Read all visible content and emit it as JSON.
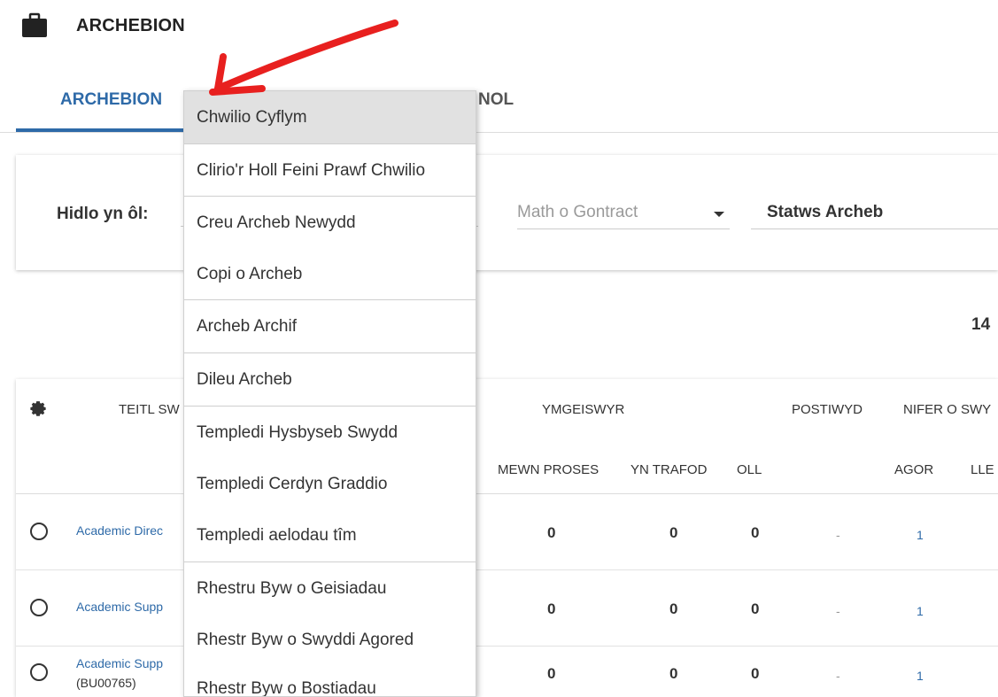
{
  "header": {
    "icon": "briefcase-icon",
    "title": "ARCHEBION"
  },
  "tabs": [
    {
      "label": "ARCHEBION",
      "active": true
    },
    {
      "label": "NOL",
      "active": false
    }
  ],
  "filter": {
    "label": "Hidlo yn ôl:",
    "contract_type_placeholder": "Math o Gontract",
    "status_label": "Statws Archeb"
  },
  "count": "14",
  "table": {
    "headers": {
      "title": "TEITL SW",
      "applicants": "YMGEISWYR",
      "posted": "POSTIWYD",
      "num_jobs": "NIFER O SWY",
      "in_process": "MEWN PROSES",
      "in_discussion": "YN TRAFOD",
      "all": "OLL",
      "open": "AGOR",
      "places": "LLE"
    },
    "rows": [
      {
        "title": "Academic Direc",
        "ref": "",
        "in_process": "0",
        "in_discussion": "0",
        "all": "0",
        "posted": "-",
        "open": "1"
      },
      {
        "title": "Academic Supp",
        "ref": "",
        "in_process": "0",
        "in_discussion": "0",
        "all": "0",
        "posted": "-",
        "open": "1"
      },
      {
        "title": "Academic Supp",
        "ref": "(BU00765)",
        "in_process": "0",
        "in_discussion": "0",
        "all": "0",
        "posted": "-",
        "open": "1"
      }
    ]
  },
  "menu": {
    "items": [
      "Chwilio Cyflym",
      "Clirio'r Holl Feini Prawf Chwilio",
      "Creu Archeb Newydd",
      "Copi o Archeb",
      "Archeb Archif",
      "Dileu Archeb",
      "Templedi Hysbyseb Swydd",
      "Templedi Cerdyn Graddio",
      "Templedi aelodau tîm",
      "Rhestru Byw o Geisiadau",
      "Rhestr Byw o Swyddi Agored",
      "Rhestr Byw o Bostiadau"
    ],
    "highlighted_index": 0
  },
  "colors": {
    "accent": "#2e6aa8",
    "arrow": "#e8201f",
    "menu_highlight": "#e1e1e1"
  }
}
